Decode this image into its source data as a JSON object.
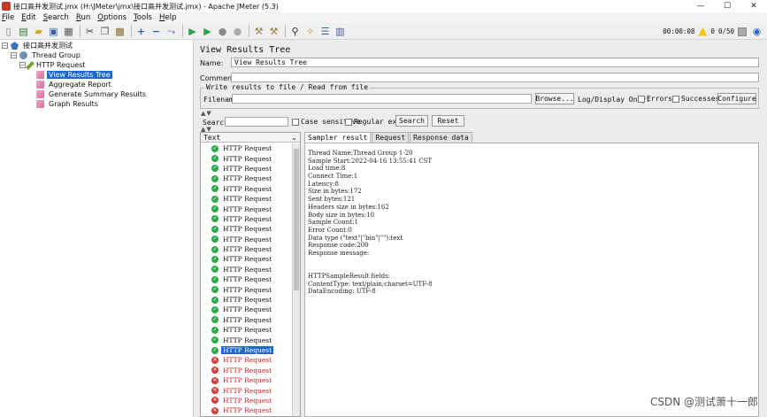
{
  "window": {
    "title": "接口高并发测试.jmx (H:\\JMeter\\jmx\\接口高并发测试.jmx) - Apache JMeter (5.3)",
    "minimize": "—",
    "maximize": "☐",
    "close": "✕"
  },
  "menu": [
    {
      "accel": "F",
      "rest": "ile"
    },
    {
      "accel": "E",
      "rest": "dit"
    },
    {
      "accel": "S",
      "rest": "earch"
    },
    {
      "accel": "R",
      "rest": "un"
    },
    {
      "accel": "O",
      "rest": "ptions"
    },
    {
      "accel": "T",
      "rest": "ools"
    },
    {
      "accel": "H",
      "rest": "elp"
    }
  ],
  "toolbar": {
    "elapsed": "00:00:08",
    "warnings": "0",
    "threads": "0/50"
  },
  "tree": {
    "test_plan": "接口高并发测试",
    "thread_group": "Thread Group",
    "http_request": "HTTP Request",
    "view_results_tree": "View Results Tree",
    "aggregate_report": "Aggregate Report",
    "summary_report": "Generate Summary Results",
    "graph_results": "Graph Results"
  },
  "panel": {
    "title": "View Results Tree",
    "name_label": "Name:",
    "name_value": "View Results Tree",
    "comments_label": "Comments:",
    "file_legend": "Write results to file / Read from file",
    "filename_label": "Filename",
    "browse_label": "Browse...",
    "logdisplay_label": "Log/Display Only:",
    "errors_label": "Errors",
    "successes_label": "Successes",
    "configure_label": "Configure",
    "search_label": "Search:",
    "case_label": "Case sensitive",
    "regex_label": "Regular exp.",
    "search_button": "Search",
    "reset_button": "Reset"
  },
  "results_list": {
    "header": "Text",
    "rows": [
      {
        "label": "HTTP Request",
        "status": "ok"
      },
      {
        "label": "HTTP Request",
        "status": "ok"
      },
      {
        "label": "HTTP Request",
        "status": "ok"
      },
      {
        "label": "HTTP Request",
        "status": "ok"
      },
      {
        "label": "HTTP Request",
        "status": "ok"
      },
      {
        "label": "HTTP Request",
        "status": "ok"
      },
      {
        "label": "HTTP Request",
        "status": "ok"
      },
      {
        "label": "HTTP Request",
        "status": "ok"
      },
      {
        "label": "HTTP Request",
        "status": "ok"
      },
      {
        "label": "HTTP Request",
        "status": "ok"
      },
      {
        "label": "HTTP Request",
        "status": "ok"
      },
      {
        "label": "HTTP Request",
        "status": "ok"
      },
      {
        "label": "HTTP Request",
        "status": "ok"
      },
      {
        "label": "HTTP Request",
        "status": "ok"
      },
      {
        "label": "HTTP Request",
        "status": "ok"
      },
      {
        "label": "HTTP Request",
        "status": "ok"
      },
      {
        "label": "HTTP Request",
        "status": "ok"
      },
      {
        "label": "HTTP Request",
        "status": "ok"
      },
      {
        "label": "HTTP Request",
        "status": "ok"
      },
      {
        "label": "HTTP Request",
        "status": "ok"
      },
      {
        "label": "HTTP Request",
        "status": "ok",
        "selected": true
      },
      {
        "label": "HTTP Request",
        "status": "fail"
      },
      {
        "label": "HTTP Request",
        "status": "fail"
      },
      {
        "label": "HTTP Request",
        "status": "fail"
      },
      {
        "label": "HTTP Request",
        "status": "fail"
      },
      {
        "label": "HTTP Request",
        "status": "fail"
      },
      {
        "label": "HTTP Request",
        "status": "fail"
      },
      {
        "label": "HTTP Request",
        "status": "fail"
      }
    ]
  },
  "tabs": [
    "Sampler result",
    "Request",
    "Response data"
  ],
  "sampler_result": [
    "Thread Name:Thread Group 1-20",
    "Sample Start:2022-04-16 13:55:41 CST",
    "Load time:8",
    "Connect Time:1",
    "Latency:8",
    "Size in bytes:172",
    "Sent bytes:121",
    "Headers size in bytes:162",
    "Body size in bytes:10",
    "Sample Count:1",
    "Error Count:0",
    "Data type (\"text\"|\"bin\"|\"\"):text",
    "Response code:200",
    "Response message:",
    "",
    "",
    "HTTPSampleResult fields:",
    "ContentType: text/plain;charset=UTF-8",
    "DataEncoding: UTF-8"
  ],
  "watermark": "CSDN @测试萧十一郎",
  "colors": {
    "selection": "#1b68d0",
    "success_icon": "#2da84a",
    "failure_icon": "#d23b3b",
    "failure_text": "#d02020"
  }
}
